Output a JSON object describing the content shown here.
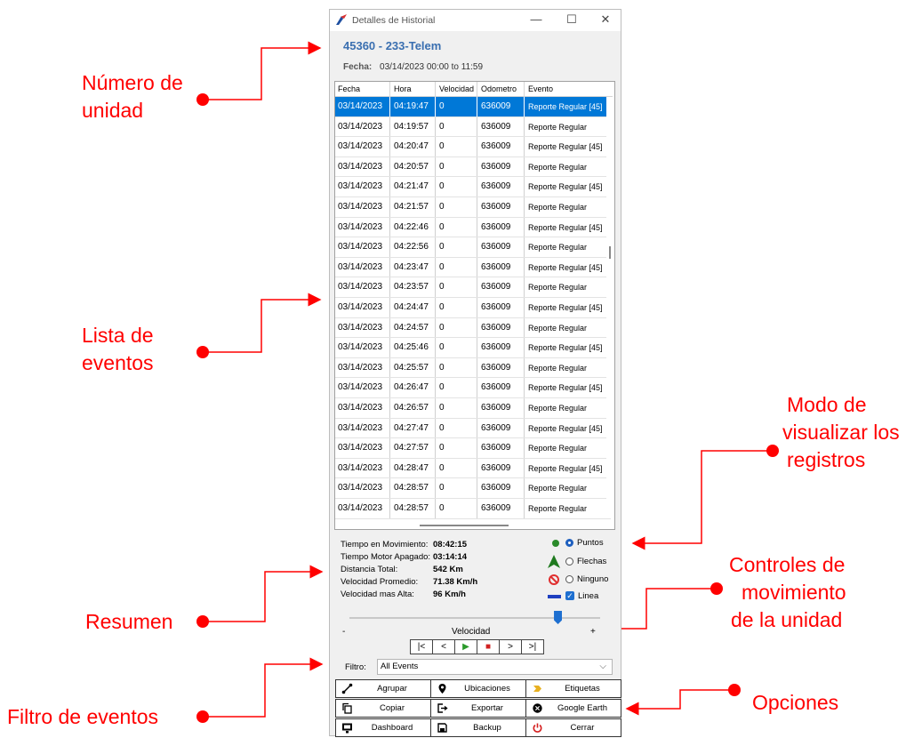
{
  "annotations": {
    "numero_unidad": [
      "Número de",
      "unidad"
    ],
    "lista_eventos": [
      "Lista de",
      "eventos"
    ],
    "resumen": "Resumen",
    "filtro_eventos": "Filtro de eventos",
    "modo_visualizar": [
      "Modo de",
      "visualizar los",
      "registros"
    ],
    "controles": [
      "Controles de",
      "movimiento",
      "de la unidad"
    ],
    "opciones": "Opciones"
  },
  "window": {
    "title": "Detalles de Historial",
    "minimize": "—",
    "maximize": "☐",
    "close": "✕",
    "unit_name": "45360 - 233-Telem",
    "fecha_label": "Fecha:",
    "fecha_value": "03/14/2023 00:00 to 11:59"
  },
  "table": {
    "columns": [
      "Fecha",
      "Hora",
      "Velocidad",
      "Odometro",
      "Evento"
    ],
    "rows": [
      [
        "03/14/2023",
        "04:19:47",
        "0",
        "636009",
        "Reporte Regular [45]"
      ],
      [
        "03/14/2023",
        "04:19:57",
        "0",
        "636009",
        "Reporte Regular"
      ],
      [
        "03/14/2023",
        "04:20:47",
        "0",
        "636009",
        "Reporte Regular [45]"
      ],
      [
        "03/14/2023",
        "04:20:57",
        "0",
        "636009",
        "Reporte Regular"
      ],
      [
        "03/14/2023",
        "04:21:47",
        "0",
        "636009",
        "Reporte Regular [45]"
      ],
      [
        "03/14/2023",
        "04:21:57",
        "0",
        "636009",
        "Reporte Regular"
      ],
      [
        "03/14/2023",
        "04:22:46",
        "0",
        "636009",
        "Reporte Regular [45]"
      ],
      [
        "03/14/2023",
        "04:22:56",
        "0",
        "636009",
        "Reporte Regular"
      ],
      [
        "03/14/2023",
        "04:23:47",
        "0",
        "636009",
        "Reporte Regular [45]"
      ],
      [
        "03/14/2023",
        "04:23:57",
        "0",
        "636009",
        "Reporte Regular"
      ],
      [
        "03/14/2023",
        "04:24:47",
        "0",
        "636009",
        "Reporte Regular [45]"
      ],
      [
        "03/14/2023",
        "04:24:57",
        "0",
        "636009",
        "Reporte Regular"
      ],
      [
        "03/14/2023",
        "04:25:46",
        "0",
        "636009",
        "Reporte Regular [45]"
      ],
      [
        "03/14/2023",
        "04:25:57",
        "0",
        "636009",
        "Reporte Regular"
      ],
      [
        "03/14/2023",
        "04:26:47",
        "0",
        "636009",
        "Reporte Regular [45]"
      ],
      [
        "03/14/2023",
        "04:26:57",
        "0",
        "636009",
        "Reporte Regular"
      ],
      [
        "03/14/2023",
        "04:27:47",
        "0",
        "636009",
        "Reporte Regular [45]"
      ],
      [
        "03/14/2023",
        "04:27:57",
        "0",
        "636009",
        "Reporte Regular"
      ],
      [
        "03/14/2023",
        "04:28:47",
        "0",
        "636009",
        "Reporte Regular [45]"
      ],
      [
        "03/14/2023",
        "04:28:57",
        "0",
        "636009",
        "Reporte Regular"
      ],
      [
        "03/14/2023",
        "04:28:57",
        "0",
        "636009",
        "Reporte Regular"
      ]
    ],
    "selected_row": 0
  },
  "summary": {
    "labels": [
      "Tiempo en Movimiento:",
      "Tiempo Motor Apagado:",
      "Distancia Total:",
      "Velocidad Promedio:",
      "Velocidad mas Alta:"
    ],
    "values": [
      "08:42:15",
      "03:14:14",
      "542 Km",
      "71.38 Km/h",
      "96 Km/h"
    ]
  },
  "display_mode": {
    "options": [
      "Puntos",
      "Flechas",
      "Ninguno"
    ],
    "selected": "Puntos",
    "linea_label": "Linea",
    "linea_checked": true
  },
  "playback": {
    "speed_label": "Velocidad",
    "minus": "-",
    "plus": "+",
    "speed_value_fraction": 0.83,
    "buttons": [
      "|<",
      "<",
      "▶",
      "■",
      ">",
      ">|"
    ]
  },
  "filter": {
    "label": "Filtro:",
    "value": "All Events"
  },
  "options": {
    "buttons": [
      {
        "label": "Agrupar",
        "icon": "group-icon"
      },
      {
        "label": "Ubicaciones",
        "icon": "location-pin-icon"
      },
      {
        "label": "Etiquetas",
        "icon": "tag-icon"
      },
      {
        "label": "Copiar",
        "icon": "copy-icon"
      },
      {
        "label": "Exportar",
        "icon": "export-icon"
      },
      {
        "label": "Google Earth",
        "icon": "globe-icon"
      },
      {
        "label": "Dashboard",
        "icon": "dashboard-icon"
      },
      {
        "label": "Backup",
        "icon": "save-icon"
      },
      {
        "label": "Cerrar",
        "icon": "power-icon"
      }
    ]
  },
  "colors": {
    "annotation": "#ff0000",
    "selection": "#0078d7",
    "unit_title": "#3a6fb0",
    "accent": "#1e6fd0"
  }
}
